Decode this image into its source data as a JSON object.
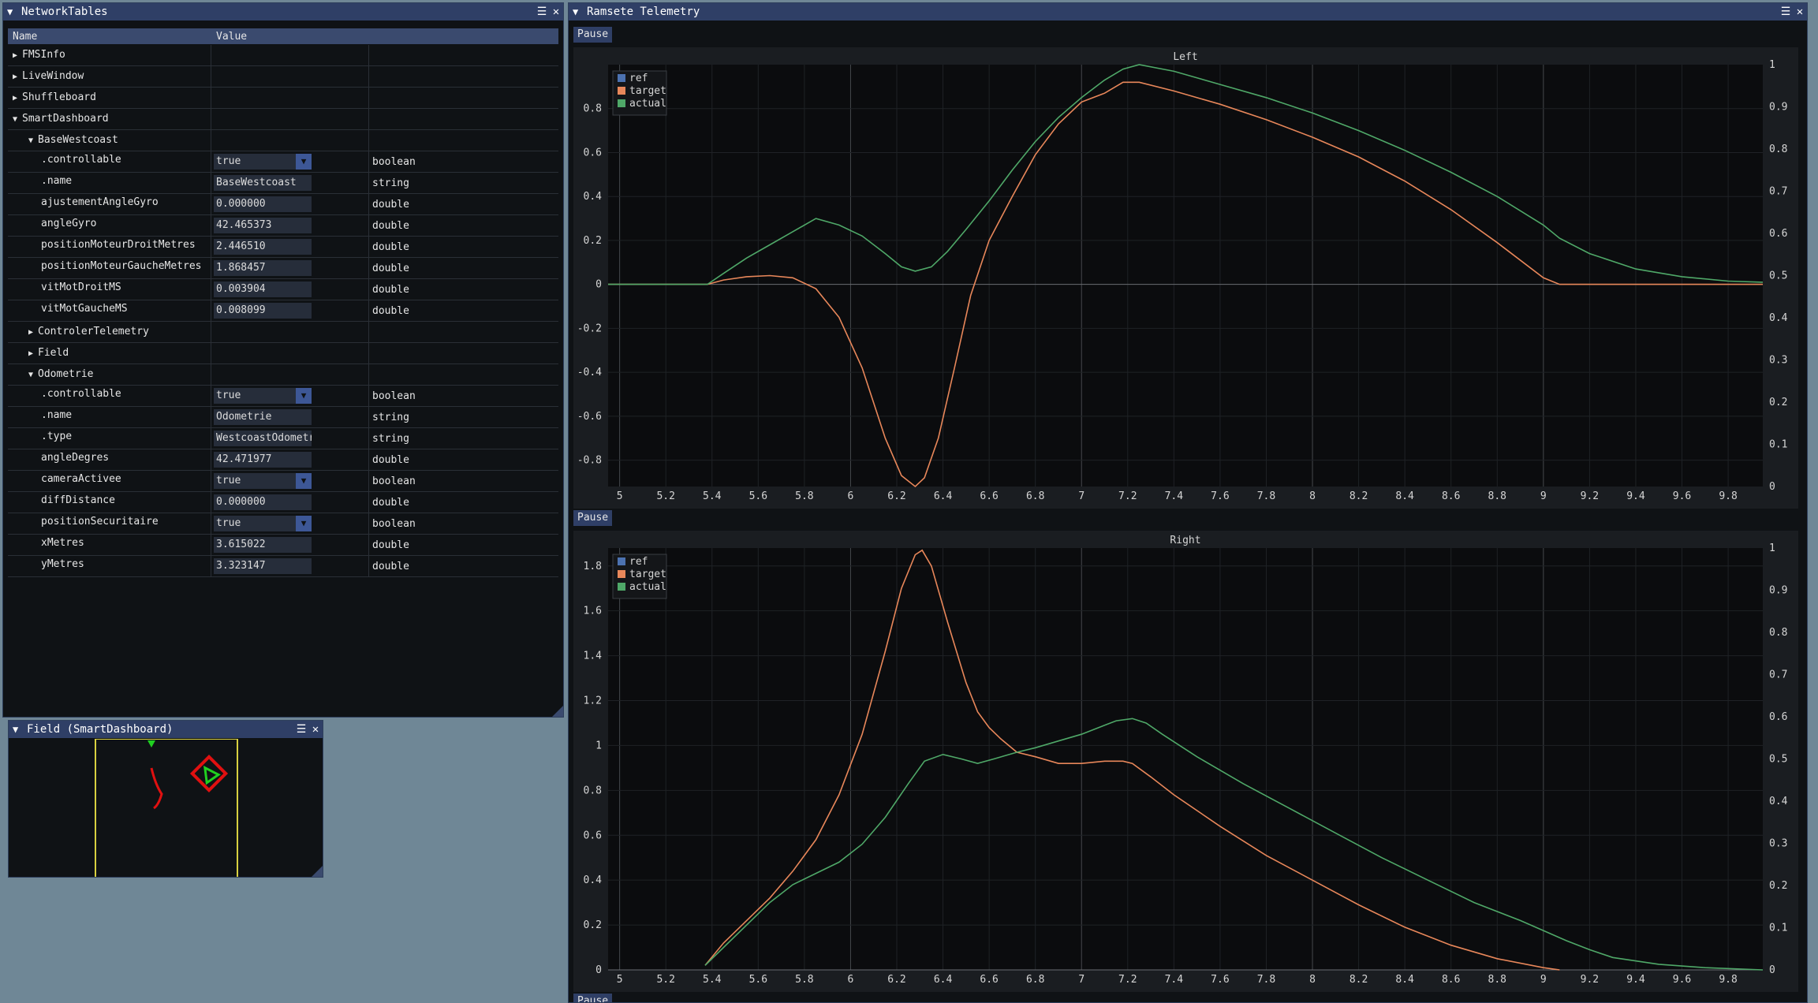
{
  "networktables": {
    "title": "NetworkTables",
    "columns": {
      "name": "Name",
      "value": "Value"
    },
    "rows": [
      {
        "indent": 0,
        "arrow": "▶",
        "name": "FMSInfo"
      },
      {
        "indent": 0,
        "arrow": "▶",
        "name": "LiveWindow"
      },
      {
        "indent": 0,
        "arrow": "▶",
        "name": "Shuffleboard"
      },
      {
        "indent": 0,
        "arrow": "▼",
        "name": "SmartDashboard"
      },
      {
        "indent": 1,
        "arrow": "▼",
        "name": "BaseWestcoast"
      },
      {
        "indent": 2,
        "name": ".controllable",
        "value": "true",
        "widget": "combo",
        "type": "boolean"
      },
      {
        "indent": 2,
        "name": ".name",
        "value": "BaseWestcoast",
        "widget": "text",
        "type": "string"
      },
      {
        "indent": 2,
        "name": "ajustementAngleGyro",
        "value": "0.000000",
        "widget": "text",
        "type": "double"
      },
      {
        "indent": 2,
        "name": "angleGyro",
        "value": "42.465373",
        "widget": "text",
        "type": "double"
      },
      {
        "indent": 2,
        "name": "positionMoteurDroitMetres",
        "value": "2.446510",
        "widget": "text",
        "type": "double"
      },
      {
        "indent": 2,
        "name": "positionMoteurGaucheMetres",
        "value": "1.868457",
        "widget": "text",
        "type": "double"
      },
      {
        "indent": 2,
        "name": "vitMotDroitMS",
        "value": "0.003904",
        "widget": "text",
        "type": "double"
      },
      {
        "indent": 2,
        "name": "vitMotGaucheMS",
        "value": "0.008099",
        "widget": "text",
        "type": "double"
      },
      {
        "indent": 1,
        "arrow": "▶",
        "name": "ControlerTelemetry"
      },
      {
        "indent": 1,
        "arrow": "▶",
        "name": "Field"
      },
      {
        "indent": 1,
        "arrow": "▼",
        "name": "Odometrie"
      },
      {
        "indent": 2,
        "name": ".controllable",
        "value": "true",
        "widget": "combo",
        "type": "boolean"
      },
      {
        "indent": 2,
        "name": ".name",
        "value": "Odometrie",
        "widget": "text",
        "type": "string"
      },
      {
        "indent": 2,
        "name": ".type",
        "value": "WestcoastOdometrie",
        "widget": "text",
        "type": "string"
      },
      {
        "indent": 2,
        "name": "angleDegres",
        "value": "42.471977",
        "widget": "text",
        "type": "double"
      },
      {
        "indent": 2,
        "name": "cameraActivee",
        "value": "true",
        "widget": "combo",
        "type": "boolean"
      },
      {
        "indent": 2,
        "name": "diffDistance",
        "value": "0.000000",
        "widget": "text",
        "type": "double"
      },
      {
        "indent": 2,
        "name": "positionSecuritaire",
        "value": "true",
        "widget": "combo",
        "type": "boolean"
      },
      {
        "indent": 2,
        "name": "xMetres",
        "value": "3.615022",
        "widget": "text",
        "type": "double"
      },
      {
        "indent": 2,
        "name": "yMetres",
        "value": "3.323147",
        "widget": "text",
        "type": "double"
      }
    ]
  },
  "field_window": {
    "title": "Field (SmartDashboard)"
  },
  "ramsete": {
    "title": "Ramsete Telemetry",
    "pause_label": "Pause"
  },
  "icons": {
    "collapse": "▼",
    "menu": "☰",
    "close": "✕"
  },
  "colors": {
    "ref": "#4c72b0",
    "target": "#e8875a",
    "actual": "#4fa868",
    "title_bar": "#2f3f66",
    "field_border": "#d8d040",
    "robot": "#e01010",
    "robot_marker": "#20d020"
  },
  "chart_data": [
    {
      "type": "line",
      "title": "Left",
      "xlim": [
        4.95,
        9.95
      ],
      "ylim": [
        -0.92,
        1.0
      ],
      "y2lim": [
        0,
        1
      ],
      "xticks": [
        "5",
        "5.2",
        "5.4",
        "5.6",
        "5.8",
        "6",
        "6.2",
        "6.4",
        "6.6",
        "6.8",
        "7",
        "7.2",
        "7.4",
        "7.6",
        "7.8",
        "8",
        "8.2",
        "8.4",
        "8.6",
        "8.8",
        "9",
        "9.2",
        "9.4",
        "9.6",
        "9.8"
      ],
      "yticks": [
        "0.8",
        "0.6",
        "0.4",
        "0.2",
        "0",
        "-0.2",
        "-0.4",
        "-0.6",
        "-0.8"
      ],
      "y2ticks": [
        "1",
        "0.9",
        "0.8",
        "0.7",
        "0.6",
        "0.5",
        "0.4",
        "0.3",
        "0.2",
        "0.1",
        "0"
      ],
      "legend": "top-left",
      "series": [
        {
          "name": "ref",
          "x": [],
          "y": []
        },
        {
          "name": "target",
          "x": [
            4.95,
            5.38,
            5.45,
            5.55,
            5.65,
            5.75,
            5.85,
            5.95,
            6.05,
            6.15,
            6.22,
            6.28,
            6.32,
            6.38,
            6.45,
            6.52,
            6.6,
            6.7,
            6.8,
            6.9,
            7.0,
            7.1,
            7.18,
            7.25,
            7.4,
            7.6,
            7.8,
            8.0,
            8.2,
            8.4,
            8.6,
            8.8,
            9.0,
            9.07,
            9.5,
            9.95
          ],
          "y": [
            0,
            0,
            0.02,
            0.035,
            0.04,
            0.03,
            -0.02,
            -0.15,
            -0.38,
            -0.7,
            -0.87,
            -0.92,
            -0.88,
            -0.7,
            -0.38,
            -0.05,
            0.2,
            0.4,
            0.59,
            0.73,
            0.83,
            0.87,
            0.92,
            0.92,
            0.88,
            0.82,
            0.75,
            0.67,
            0.58,
            0.47,
            0.34,
            0.19,
            0.03,
            0,
            0,
            0
          ]
        },
        {
          "name": "actual",
          "x": [
            4.95,
            5.38,
            5.45,
            5.55,
            5.65,
            5.75,
            5.85,
            5.95,
            6.05,
            6.15,
            6.22,
            6.28,
            6.35,
            6.42,
            6.5,
            6.6,
            6.7,
            6.8,
            6.9,
            7.0,
            7.1,
            7.18,
            7.25,
            7.4,
            7.6,
            7.8,
            8.0,
            8.2,
            8.4,
            8.6,
            8.8,
            9.0,
            9.07,
            9.2,
            9.4,
            9.6,
            9.8,
            9.95
          ],
          "y": [
            0,
            0,
            0.05,
            0.12,
            0.18,
            0.24,
            0.3,
            0.27,
            0.22,
            0.14,
            0.08,
            0.06,
            0.08,
            0.15,
            0.25,
            0.38,
            0.52,
            0.65,
            0.76,
            0.85,
            0.93,
            0.98,
            1.0,
            0.97,
            0.91,
            0.85,
            0.78,
            0.7,
            0.61,
            0.51,
            0.4,
            0.27,
            0.21,
            0.14,
            0.07,
            0.035,
            0.015,
            0.01
          ]
        }
      ]
    },
    {
      "type": "line",
      "title": "Right",
      "xlim": [
        4.95,
        9.95
      ],
      "ylim": [
        0,
        1.88
      ],
      "y2lim": [
        0,
        1
      ],
      "xticks": [
        "5",
        "5.2",
        "5.4",
        "5.6",
        "5.8",
        "6",
        "6.2",
        "6.4",
        "6.6",
        "6.8",
        "7",
        "7.2",
        "7.4",
        "7.6",
        "7.8",
        "8",
        "8.2",
        "8.4",
        "8.6",
        "8.8",
        "9",
        "9.2",
        "9.4",
        "9.6",
        "9.8"
      ],
      "yticks": [
        "1.8",
        "1.6",
        "1.4",
        "1.2",
        "1",
        "0.8",
        "0.6",
        "0.4",
        "0.2",
        "0"
      ],
      "y2ticks": [
        "1",
        "0.9",
        "0.8",
        "0.7",
        "0.6",
        "0.5",
        "0.4",
        "0.3",
        "0.2",
        "0.1",
        "0"
      ],
      "legend": "top-left",
      "series": [
        {
          "name": "ref",
          "x": [],
          "y": []
        },
        {
          "name": "target",
          "x": [
            5.37,
            5.45,
            5.55,
            5.65,
            5.75,
            5.85,
            5.95,
            6.05,
            6.15,
            6.22,
            6.28,
            6.31,
            6.35,
            6.42,
            6.5,
            6.55,
            6.6,
            6.65,
            6.72,
            6.8,
            6.9,
            7.0,
            7.1,
            7.18,
            7.22,
            7.3,
            7.4,
            7.6,
            7.8,
            8.0,
            8.2,
            8.4,
            8.6,
            8.8,
            9.0,
            9.07
          ],
          "y": [
            0.02,
            0.12,
            0.22,
            0.32,
            0.44,
            0.58,
            0.78,
            1.05,
            1.42,
            1.7,
            1.85,
            1.87,
            1.8,
            1.55,
            1.28,
            1.15,
            1.08,
            1.03,
            0.97,
            0.95,
            0.92,
            0.92,
            0.93,
            0.93,
            0.92,
            0.86,
            0.78,
            0.64,
            0.51,
            0.4,
            0.29,
            0.19,
            0.11,
            0.05,
            0.01,
            0
          ]
        },
        {
          "name": "actual",
          "x": [
            5.37,
            5.45,
            5.55,
            5.65,
            5.75,
            5.85,
            5.95,
            6.05,
            6.15,
            6.25,
            6.32,
            6.4,
            6.48,
            6.55,
            6.62,
            6.72,
            6.8,
            6.9,
            7.0,
            7.1,
            7.15,
            7.22,
            7.28,
            7.35,
            7.5,
            7.7,
            7.9,
            8.1,
            8.3,
            8.5,
            8.7,
            8.9,
            9.1,
            9.2,
            9.3,
            9.5,
            9.7,
            9.95
          ],
          "y": [
            0.02,
            0.1,
            0.2,
            0.3,
            0.38,
            0.43,
            0.48,
            0.56,
            0.68,
            0.83,
            0.93,
            0.96,
            0.94,
            0.92,
            0.94,
            0.97,
            0.99,
            1.02,
            1.05,
            1.09,
            1.11,
            1.12,
            1.1,
            1.05,
            0.95,
            0.83,
            0.72,
            0.61,
            0.5,
            0.4,
            0.3,
            0.22,
            0.13,
            0.09,
            0.055,
            0.025,
            0.01,
            0
          ]
        }
      ]
    }
  ]
}
